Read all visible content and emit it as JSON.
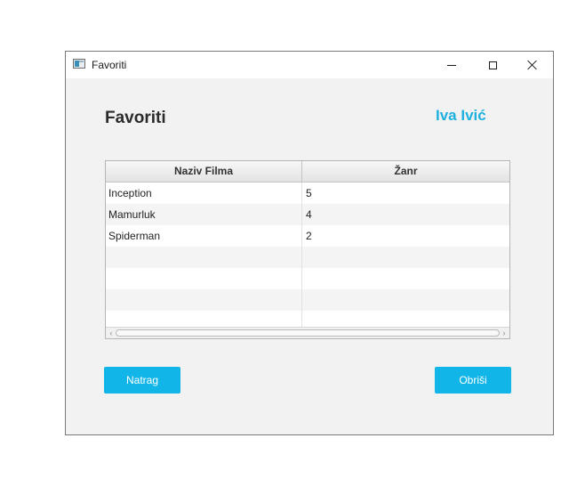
{
  "window": {
    "title": "Favoriti",
    "controls": {
      "minimize": "minimize-icon",
      "maximize": "maximize-icon",
      "close": "close-icon"
    }
  },
  "header": {
    "title": "Favoriti",
    "user_name": "Iva Ivić"
  },
  "table": {
    "columns": [
      "Naziv Filma",
      "Žanr"
    ],
    "rows": [
      {
        "naziv": "Inception",
        "zanr": "5"
      },
      {
        "naziv": "Mamurluk",
        "zanr": "4"
      },
      {
        "naziv": "Spiderman",
        "zanr": "2"
      },
      {
        "naziv": "",
        "zanr": ""
      },
      {
        "naziv": "",
        "zanr": ""
      },
      {
        "naziv": "",
        "zanr": ""
      },
      {
        "naziv": "",
        "zanr": ""
      }
    ]
  },
  "buttons": {
    "back_label": "Natrag",
    "delete_label": "Obriši"
  },
  "colors": {
    "accent": "#12b5e8",
    "username": "#1eb0df",
    "window_bg": "#f2f2f2"
  }
}
